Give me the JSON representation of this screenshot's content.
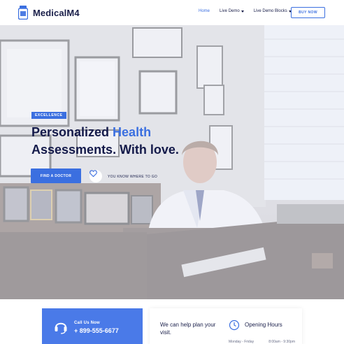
{
  "header": {
    "brand": "MedicalM4",
    "nav": [
      {
        "label": "Home",
        "active": true,
        "dropdown": false
      },
      {
        "label": "Live Demo",
        "active": false,
        "dropdown": true
      },
      {
        "label": "Live Demo Blocks",
        "active": false,
        "dropdown": true
      }
    ],
    "buy_label": "BUY NOW"
  },
  "hero": {
    "badge": "EXCELLENCE",
    "title_line1_part1": "Personalized ",
    "title_line1_accent": "Health",
    "title_line2": "Assessments. With love.",
    "cta_label": "FIND A DOCTOR",
    "tagline": "YOU KNOW WHERE TO GO"
  },
  "contact": {
    "call_label": "Call Us Now",
    "phone": "+ 899-555-6677"
  },
  "info": {
    "help_text": "We can help plan your visit.",
    "hours_title": "Opening Hours",
    "hours_day": "Monday - Friday",
    "hours_time": "8:00am - 9:30pm"
  },
  "colors": {
    "accent": "#3b6fe0",
    "navy": "#141a4a",
    "call_bg": "#4a7ae8"
  },
  "icons": [
    "pill-bottle-icon",
    "caret-down-icon",
    "heart-icon",
    "headset-icon",
    "clock-icon"
  ]
}
